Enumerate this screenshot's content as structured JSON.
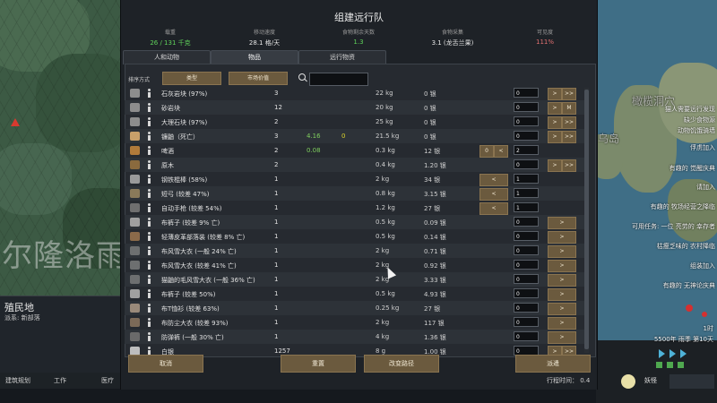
{
  "dialog": {
    "title": "组建远行队",
    "stats": [
      {
        "label": "载重",
        "value": "26 / 131 千克",
        "color": "#5fd15a"
      },
      {
        "label": "移动速度",
        "value": "28.1 格/天",
        "color": "#e6e6e6"
      },
      {
        "label": "食物剩余天数",
        "value": "1.3",
        "color": "#5fd15a"
      },
      {
        "label": "食物采集",
        "value": "3.1 (龙舌兰果)",
        "color": "#e6e6e6"
      },
      {
        "label": "可见度",
        "value": "111%",
        "color": "#e07070"
      }
    ],
    "tabs": [
      "人和动物",
      "物品",
      "远行物资"
    ],
    "active_tab": 1,
    "sort_label": "排序方式",
    "sort_buttons": [
      "类型",
      "市场价值"
    ],
    "search_placeholder": "",
    "items": [
      {
        "name": "石灰岩块 (97%)",
        "count": "3",
        "g1": "",
        "g2": "",
        "mass": "22 kg",
        "price": "0 银",
        "qty": "0",
        "buttons": [
          ">",
          ">>"
        ],
        "icon": "stone-block-icon"
      },
      {
        "name": "砂岩块",
        "count": "12",
        "g1": "",
        "g2": "",
        "mass": "20 kg",
        "price": "0 银",
        "qty": "0",
        "buttons": [
          ">",
          "M"
        ],
        "icon": "stone-block-icon"
      },
      {
        "name": "大理石块 (97%)",
        "count": "2",
        "g1": "",
        "g2": "",
        "mass": "25 kg",
        "price": "0 银",
        "qty": "0",
        "buttons": [
          ">",
          ">>"
        ],
        "icon": "stone-block-icon"
      },
      {
        "name": "镰鼬（死亡）",
        "count": "3",
        "g1": "4.16",
        "g2": "0",
        "mass": "21.5 kg",
        "price": "0 银",
        "qty": "0",
        "buttons": [
          ">",
          ">>"
        ],
        "icon": "animal-corpse-icon"
      },
      {
        "name": "啤酒",
        "count": "2",
        "g1": "0.08",
        "g2": "",
        "mass": "0.3 kg",
        "price": "12 银",
        "qty": "2",
        "buttons": [
          "0",
          "<"
        ],
        "icon": "beer-icon"
      },
      {
        "name": "原木",
        "count": "2",
        "g1": "",
        "g2": "",
        "mass": "0.4 kg",
        "price": "1.20 银",
        "qty": "0",
        "buttons": [
          ">",
          ">>"
        ],
        "icon": "wood-log-icon"
      },
      {
        "name": "钢铁棍棒 (58%)",
        "count": "1",
        "g1": "",
        "g2": "",
        "mass": "2 kg",
        "price": "34 银",
        "qty": "1",
        "buttons": [
          "<"
        ],
        "icon": "club-icon"
      },
      {
        "name": "短弓 (较差 47%)",
        "count": "1",
        "g1": "",
        "g2": "",
        "mass": "0.8 kg",
        "price": "3.15 银",
        "qty": "1",
        "buttons": [
          "<"
        ],
        "icon": "bow-icon"
      },
      {
        "name": "自动手枪 (较差 54%)",
        "count": "1",
        "g1": "",
        "g2": "",
        "mass": "1.2 kg",
        "price": "27 银",
        "qty": "1",
        "buttons": [
          "<"
        ],
        "icon": "pistol-icon"
      },
      {
        "name": "布裤子 (较差 9% 亡)",
        "count": "1",
        "g1": "",
        "g2": "",
        "mass": "0.5 kg",
        "price": "0.09 银",
        "qty": "0",
        "buttons": [
          ">"
        ],
        "icon": "pants-icon"
      },
      {
        "name": "轻薄皮革部落装 (较差 8% 亡)",
        "count": "1",
        "g1": "",
        "g2": "",
        "mass": "0.5 kg",
        "price": "0.14 银",
        "qty": "0",
        "buttons": [
          ">"
        ],
        "icon": "tribalwear-icon"
      },
      {
        "name": "布风雪大衣 (一般 24% 亡)",
        "count": "1",
        "g1": "",
        "g2": "",
        "mass": "2 kg",
        "price": "0.71 银",
        "qty": "0",
        "buttons": [
          ">"
        ],
        "icon": "parka-icon"
      },
      {
        "name": "布风雪大衣 (较差 41% 亡)",
        "count": "1",
        "g1": "",
        "g2": "",
        "mass": "2 kg",
        "price": "0.92 银",
        "qty": "0",
        "buttons": [
          ">"
        ],
        "icon": "parka-icon"
      },
      {
        "name": "猫鼬的毛风雪大衣 (一般 36% 亡)",
        "count": "1",
        "g1": "",
        "g2": "",
        "mass": "2 kg",
        "price": "3.33 银",
        "qty": "0",
        "buttons": [
          ">"
        ],
        "icon": "parka-icon"
      },
      {
        "name": "布裤子 (较差 50%)",
        "count": "1",
        "g1": "",
        "g2": "",
        "mass": "0.5 kg",
        "price": "4.93 银",
        "qty": "0",
        "buttons": [
          ">"
        ],
        "icon": "pants-icon"
      },
      {
        "name": "布T恤衫 (较差 63%)",
        "count": "1",
        "g1": "",
        "g2": "",
        "mass": "0.25 kg",
        "price": "27 银",
        "qty": "0",
        "buttons": [
          ">"
        ],
        "icon": "tshirt-icon"
      },
      {
        "name": "布防尘大衣 (较差 93%)",
        "count": "1",
        "g1": "",
        "g2": "",
        "mass": "2 kg",
        "price": "117 银",
        "qty": "0",
        "buttons": [
          ">"
        ],
        "icon": "duster-icon"
      },
      {
        "name": "防弹裤 (一般 30% 亡)",
        "count": "1",
        "g1": "",
        "g2": "",
        "mass": "4 kg",
        "price": "1.36 银",
        "qty": "0",
        "buttons": [
          ">"
        ],
        "icon": "flak-pants-icon"
      },
      {
        "name": "白银",
        "count": "1257",
        "g1": "",
        "g2": "",
        "mass": "8 g",
        "price": "1.00 银",
        "qty": "0",
        "buttons": [
          ">",
          ">>"
        ],
        "icon": "silver-icon"
      }
    ],
    "buttons": {
      "cancel": "取消",
      "reset": "重置",
      "change_route": "改变路径",
      "send": "派遣"
    },
    "travel_time": "行程时间： 0.4"
  },
  "left": {
    "map_label": "尔隆洛雨",
    "colony_name": "殖民地",
    "colony_faction": "派系: 新部落",
    "tabs": [
      "建筑规划",
      "工作",
      "医疗"
    ]
  },
  "right": {
    "map_big_label": "橄榄洞穴",
    "map_small_label": "乌岛",
    "alerts": [
      "猫人需要远行发现",
      "缺少食物源",
      "动物饥饿骑墙",
      "俘虏加入",
      "有趣的 觉醒庆典",
      "请加入",
      "有趣的 牧场经营之降临",
      "可用任务: 一位 亮劳的 幸存者",
      "枯瘦乏味的 农村降临",
      "组装加入",
      "有趣的 无神论庆典"
    ],
    "clock": "1时",
    "date": "5500年 雨季 第10天",
    "bottom_label": "妖怪"
  },
  "colors": {
    "accent_button": "#6b5a3e",
    "green": "#5fd15a",
    "yellow": "#d9d22c",
    "red": "#e07070"
  }
}
